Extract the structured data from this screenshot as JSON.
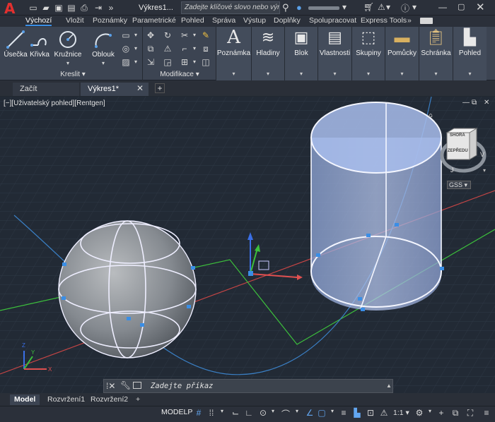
{
  "app": {
    "logo": "A",
    "document_title": "Výkres1...",
    "search_placeholder": "Zadejte klíčové slovo nebo výraz"
  },
  "colors": {
    "accent": "#3a8ee6",
    "logo_red": "#e2302f",
    "axis_x": "#e05050",
    "axis_y": "#3cbf3c",
    "axis_z": "#3a6fe6",
    "cylinder": "#b8c8f0"
  },
  "ribbon_tabs": [
    "Výchozí",
    "Vložit",
    "Poznámky",
    "Parametrické",
    "Pohled",
    "Správa",
    "Výstup",
    "Doplňky",
    "Spolupracovat",
    "Express Tools"
  ],
  "ribbon": {
    "draw_panel": {
      "title": "Kreslit",
      "buttons": [
        "Úsečka",
        "Křivka",
        "Kružnice",
        "Oblouk"
      ]
    },
    "modify_panel": {
      "title": "Modifikace"
    },
    "collapsed_panels": [
      "Poznámka",
      "Hladiny",
      "Blok",
      "Vlastnosti",
      "Skupiny",
      "Pomůcky",
      "Schránka",
      "Pohled"
    ]
  },
  "file_tabs": [
    "Začít",
    "Výkres1*"
  ],
  "viewport": {
    "label": "[−][Uživatelský pohled][Rentgen]",
    "viewcube_top": "SHORA",
    "viewcube_front": "ZEPŘEDU",
    "viewcube_s": "J",
    "viewcube_w": "V",
    "ucs_button": "GSS"
  },
  "command_line": {
    "placeholder": "Zadejte příkaz"
  },
  "layout_tabs": [
    "Model",
    "Rozvržení1",
    "Rozvržení2"
  ],
  "status_bar": {
    "model_label": "MODELP",
    "scale": "1:1"
  }
}
